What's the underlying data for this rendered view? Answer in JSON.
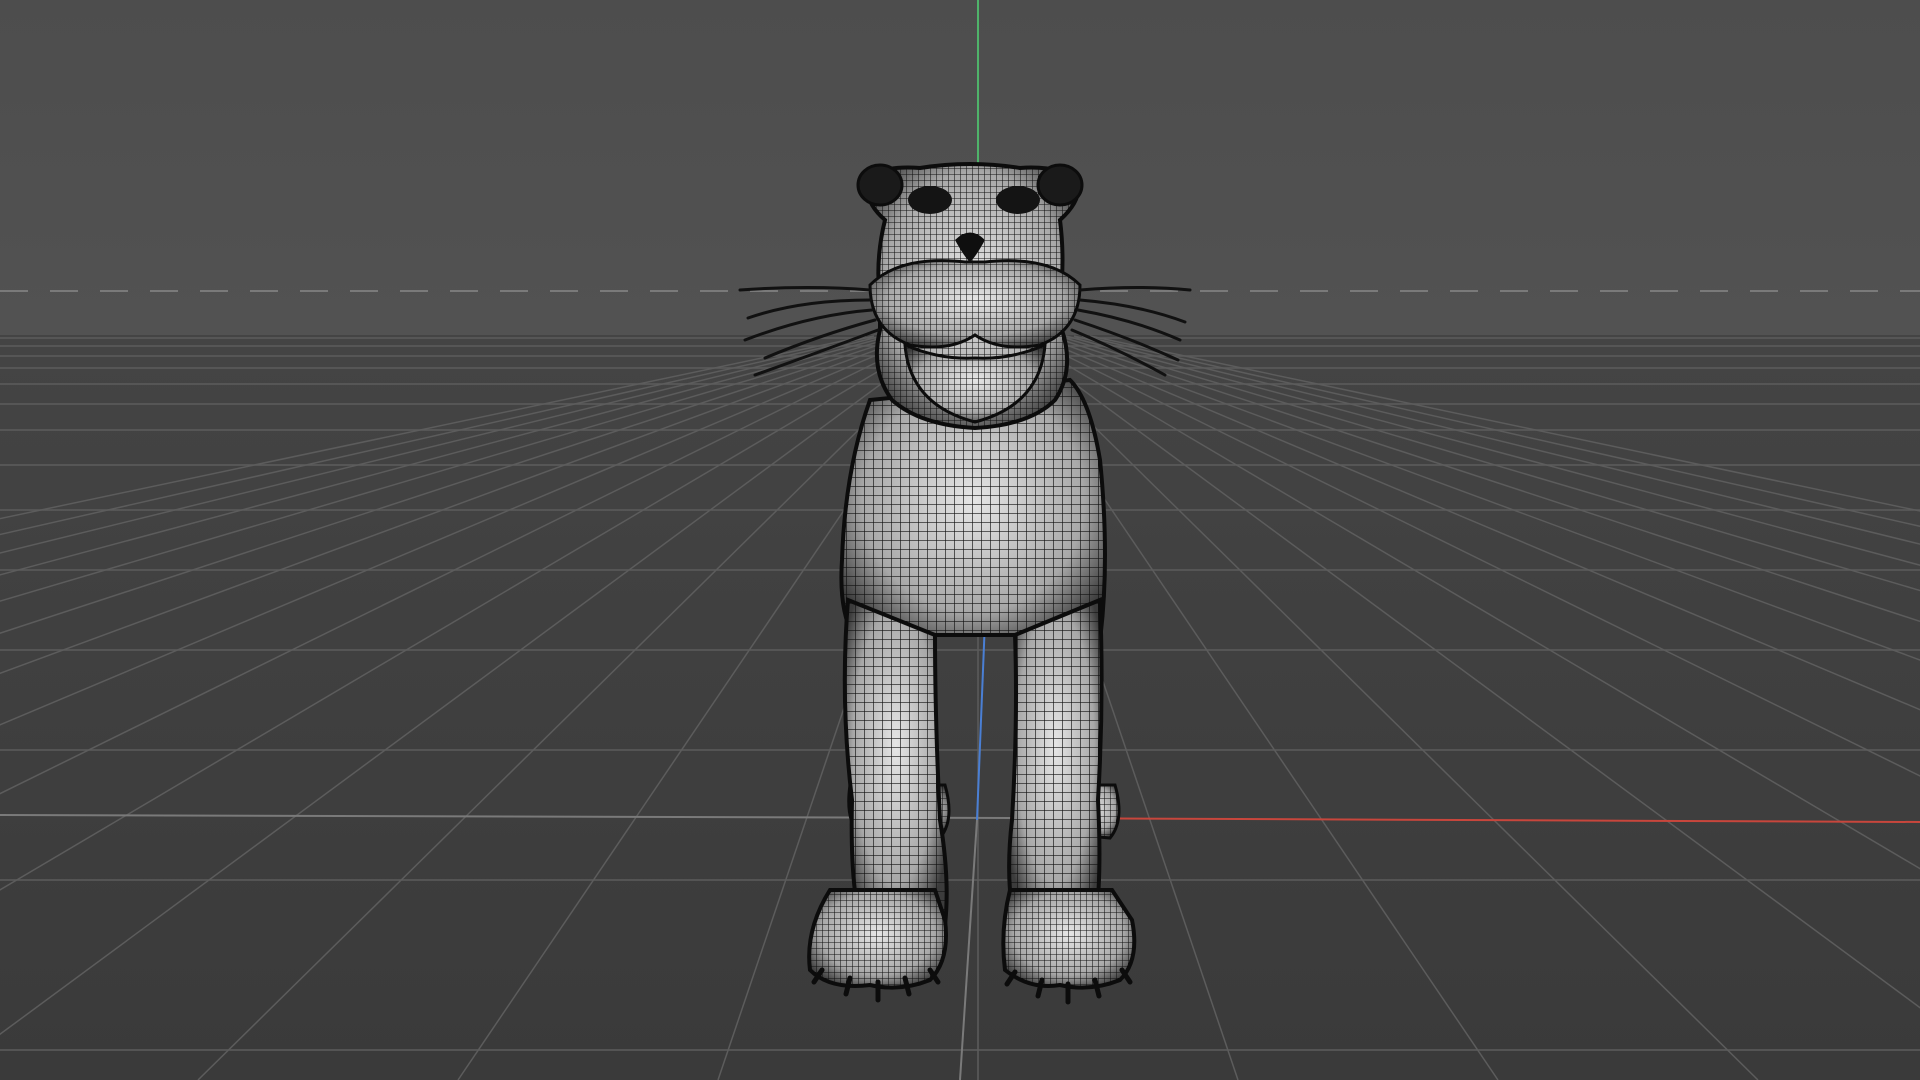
{
  "viewport": {
    "background": "#4a4a4a",
    "horizon_color": "#505050",
    "floor_color": "#3a3a3a",
    "grid_color": "#5c5c5c",
    "axis_x_color": "#c8463c",
    "axis_y_color": "#4fb36a",
    "axis_z_color": "#4a7fd4"
  },
  "model": {
    "name_icon": "panther-wireframe-icon",
    "wire_color": "#0c0c0c",
    "surface_color": "#d8d8d8",
    "display_mode": "wireframe-on-shaded"
  }
}
